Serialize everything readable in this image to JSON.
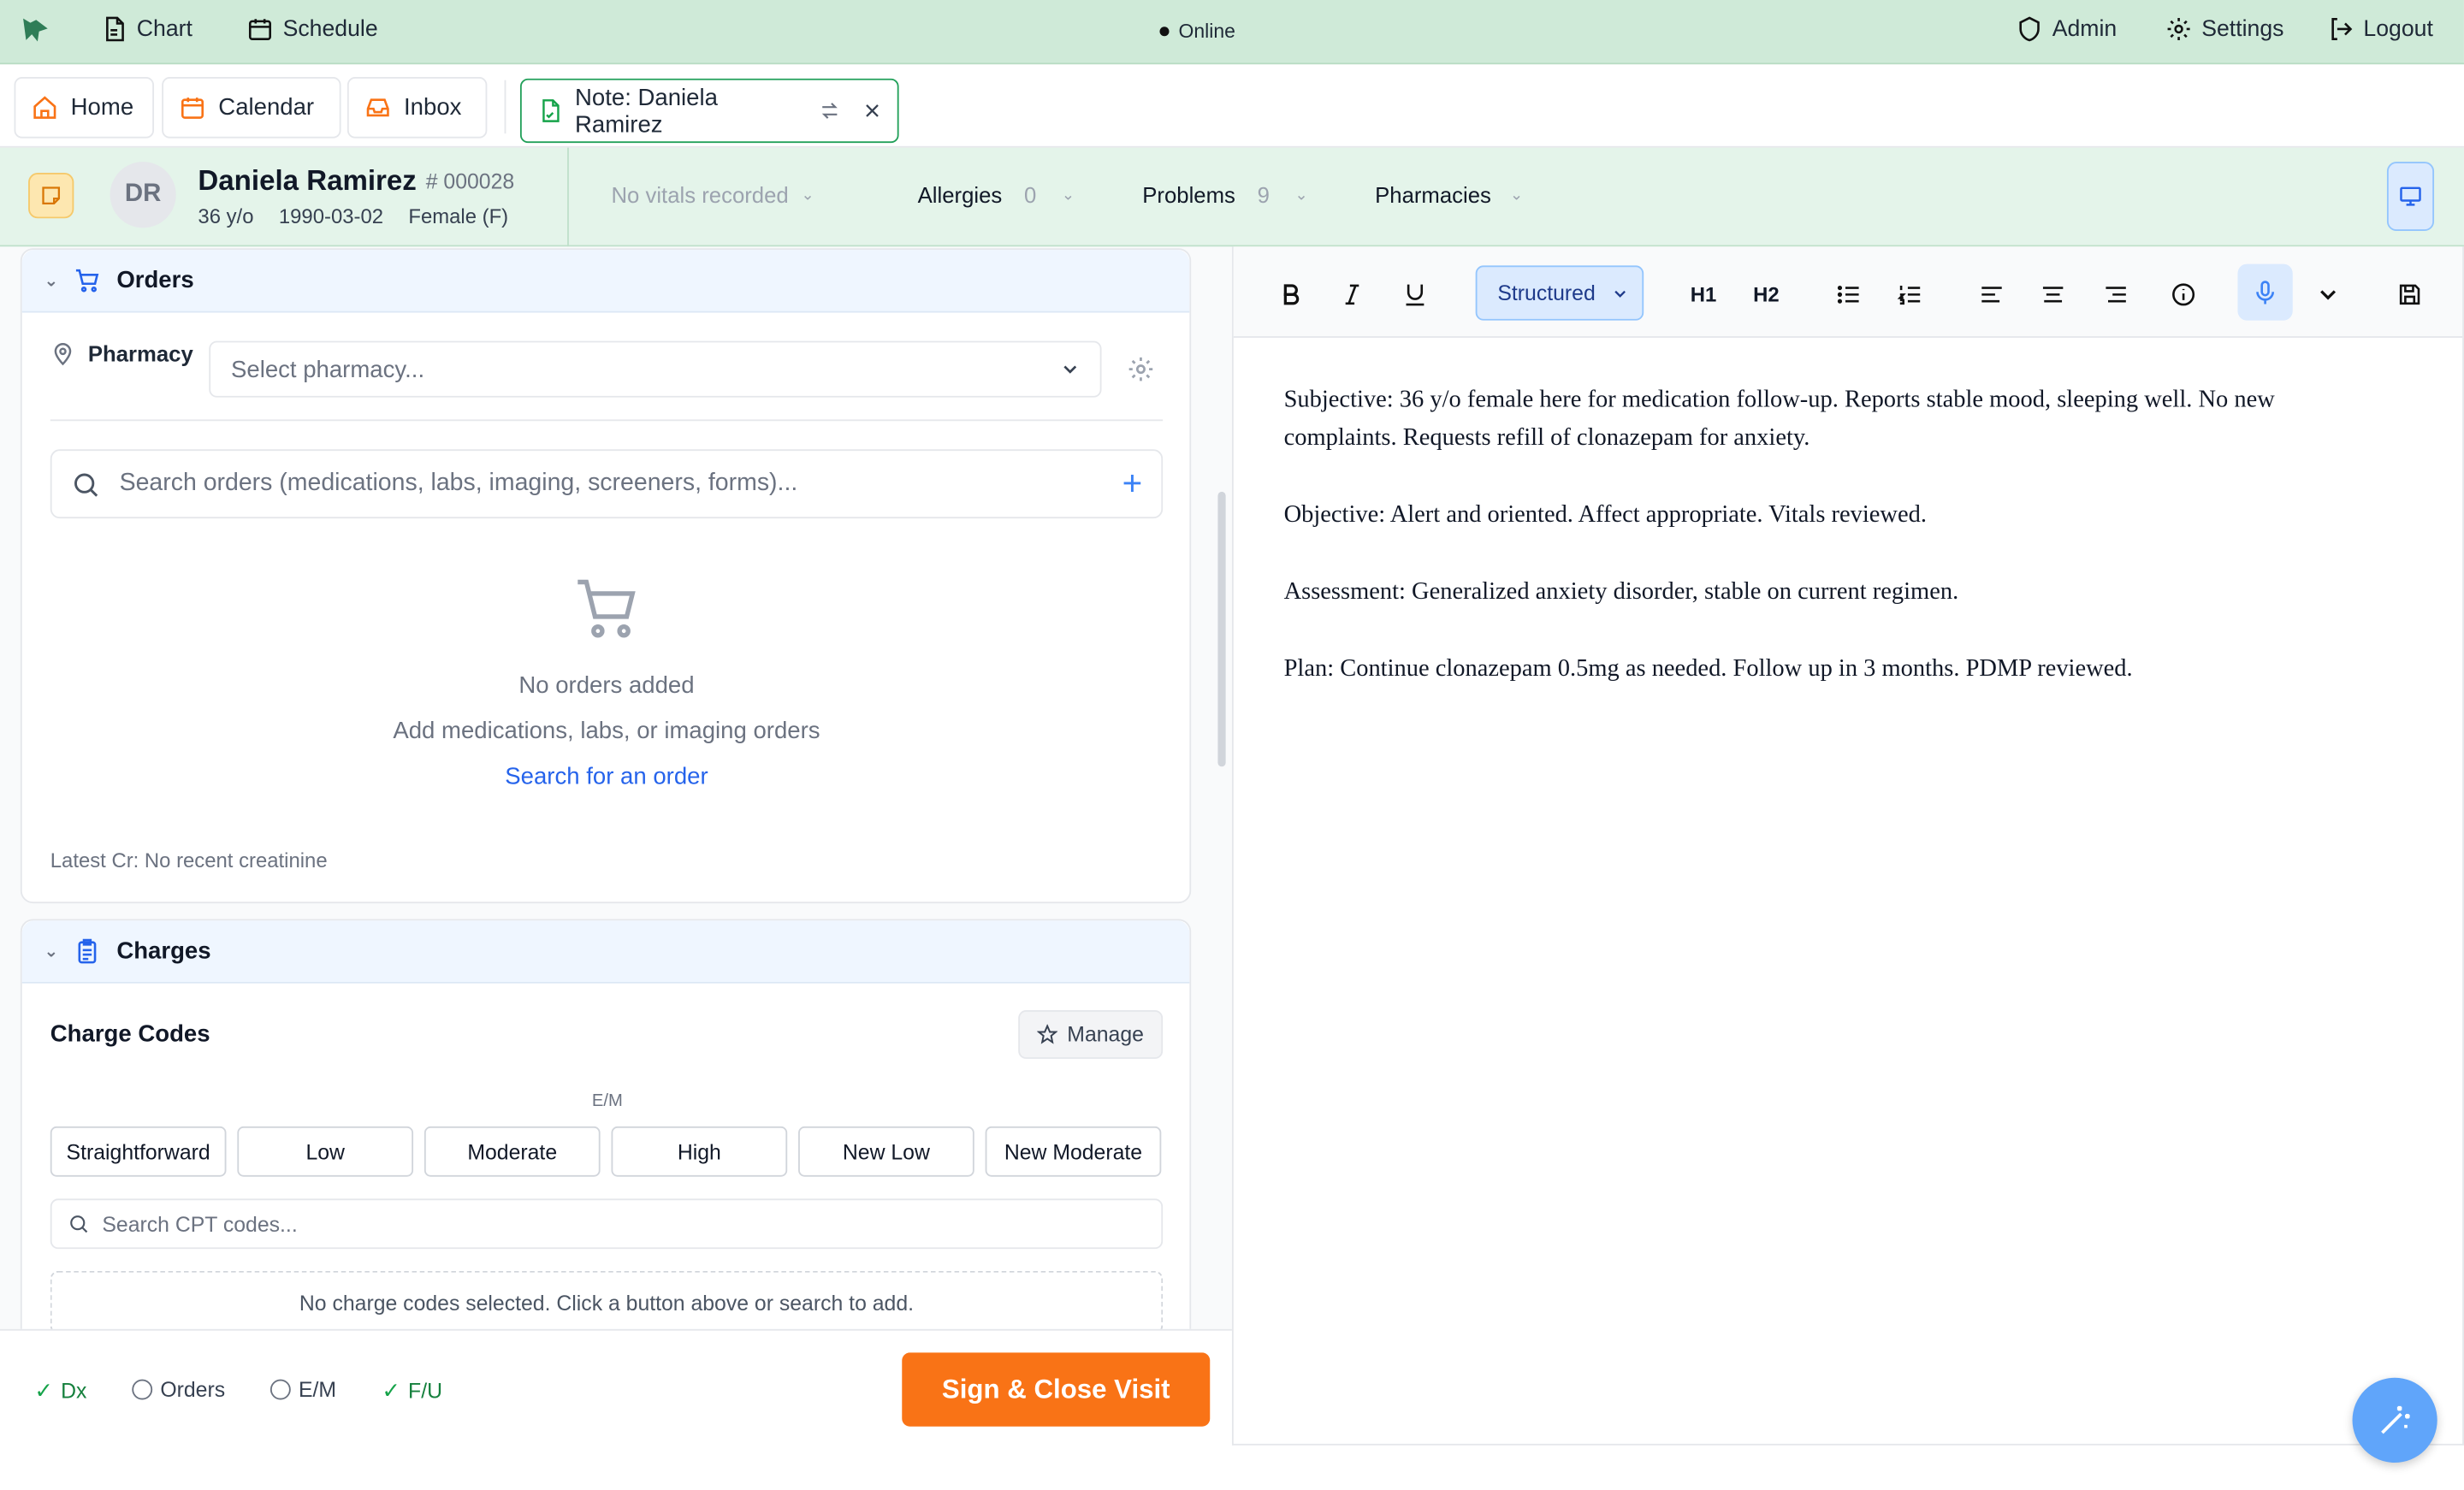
{
  "topnav": {
    "chart_label": "Chart",
    "schedule_label": "Schedule",
    "status": "Online",
    "admin_label": "Admin",
    "settings_label": "Settings",
    "logout_label": "Logout"
  },
  "tabs": [
    {
      "label": "Home",
      "icon": "home-icon"
    },
    {
      "label": "Calendar",
      "icon": "calendar-icon"
    },
    {
      "label": "Inbox",
      "icon": "inbox-icon"
    },
    {
      "label": "Note: Daniela Ramirez",
      "icon": "note-icon",
      "active": true
    }
  ],
  "patient": {
    "initials": "DR",
    "name": "Daniela Ramirez",
    "mrn": "# 000028",
    "age": "36 y/o",
    "dob": "1990-03-02",
    "sex": "Female (F)",
    "vitals": "No vitals recorded",
    "allergies_label": "Allergies",
    "allergies_count": "0",
    "problems_label": "Problems",
    "problems_count": "9",
    "pharmacies_label": "Pharmacies"
  },
  "orders": {
    "title": "Orders",
    "pharmacy_label": "Pharmacy",
    "pharmacy_placeholder": "Select pharmacy...",
    "search_placeholder": "Search orders (medications, labs, imaging, screeners, forms)...",
    "empty_title": "No orders added",
    "empty_subtitle": "Add medications, labs, or imaging orders",
    "empty_link": "Search for an order",
    "latest_cr": "Latest Cr: No recent creatinine"
  },
  "charges": {
    "title": "Charges",
    "codes_title": "Charge Codes",
    "manage_label": "Manage",
    "em_label": "E/M",
    "em_buttons": [
      "Straightforward",
      "Low",
      "Moderate",
      "High",
      "New Low",
      "New Moderate"
    ],
    "cpt_placeholder": "Search CPT codes...",
    "empty": "No charge codes selected. Click a button above or search to add."
  },
  "checklist": [
    {
      "label": "Dx",
      "done": true
    },
    {
      "label": "Orders",
      "done": false
    },
    {
      "label": "E/M",
      "done": false
    },
    {
      "label": "F/U",
      "done": true
    }
  ],
  "sign_button": "Sign & Close Visit",
  "editor": {
    "format": "Structured",
    "h1": "H1",
    "h2": "H2",
    "paragraphs": [
      "Subjective: 36 y/o female here for medication follow-up. Reports stable mood, sleeping well. No new complaints. Requests refill of clonazepam for anxiety.",
      "Objective: Alert and oriented. Affect appropriate. Vitals reviewed.",
      "Assessment: Generalized anxiety disorder, stable on current regimen.",
      "Plan: Continue clonazepam 0.5mg as needed. Follow up in 3 months. PDMP reviewed."
    ]
  },
  "colors": {
    "topnav_bg": "#cfead8",
    "accent_orange": "#f97316",
    "link_blue": "#2563eb",
    "active_tab_border": "#22a05a"
  }
}
